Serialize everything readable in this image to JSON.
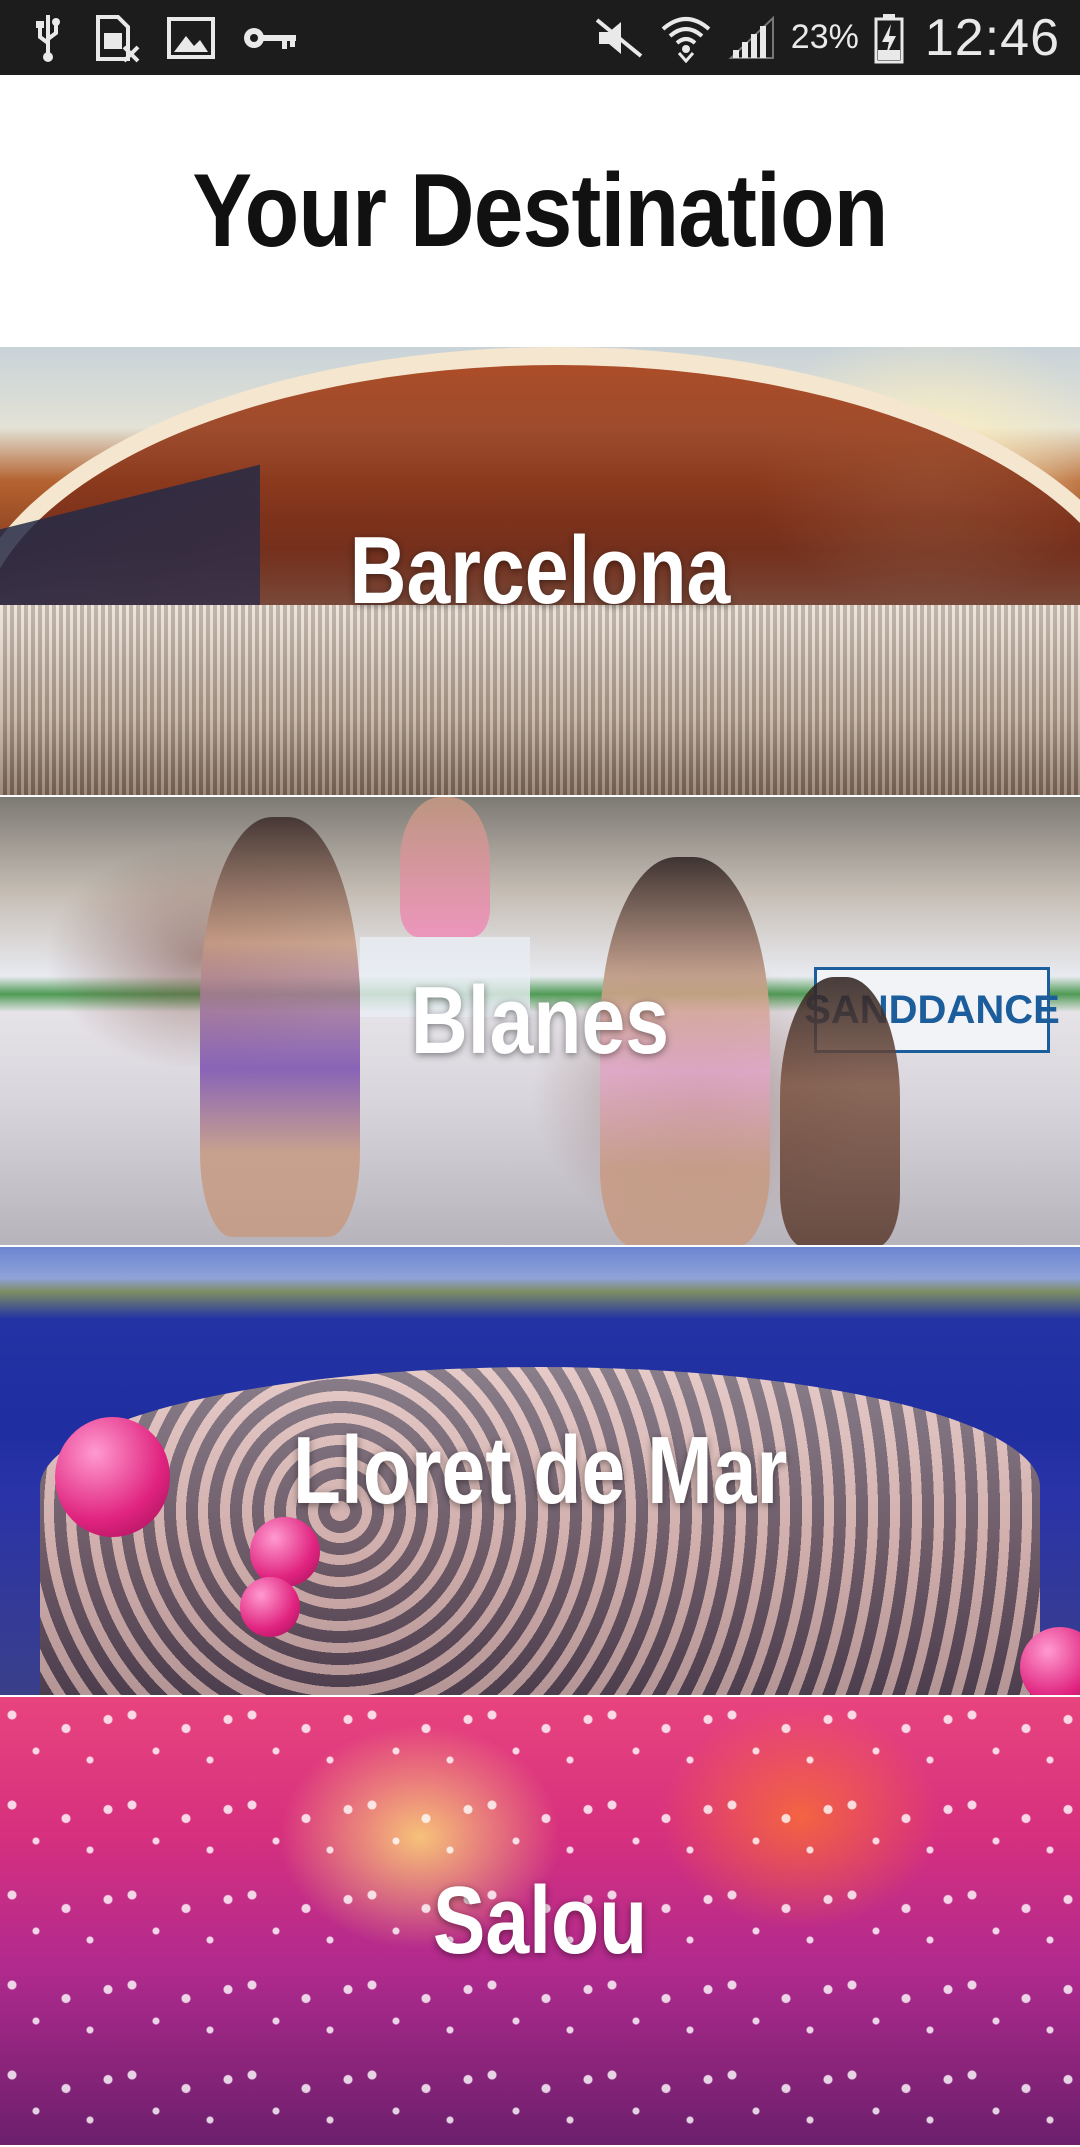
{
  "status_bar": {
    "left_icons": [
      "usb-icon",
      "sim-card-missing-icon",
      "image-icon",
      "key-icon"
    ],
    "right_icons": [
      "mute-icon",
      "wifi-icon",
      "signal-icon"
    ],
    "battery_percent": "23%",
    "battery_icon": "battery-charging-icon",
    "time": "12:46",
    "background": "#1c1c1c"
  },
  "page": {
    "title": "Your Destination"
  },
  "destinations": [
    {
      "name": "Barcelona"
    },
    {
      "name": "Blanes"
    },
    {
      "name": "Lloret de Mar"
    },
    {
      "name": "Salou"
    }
  ]
}
